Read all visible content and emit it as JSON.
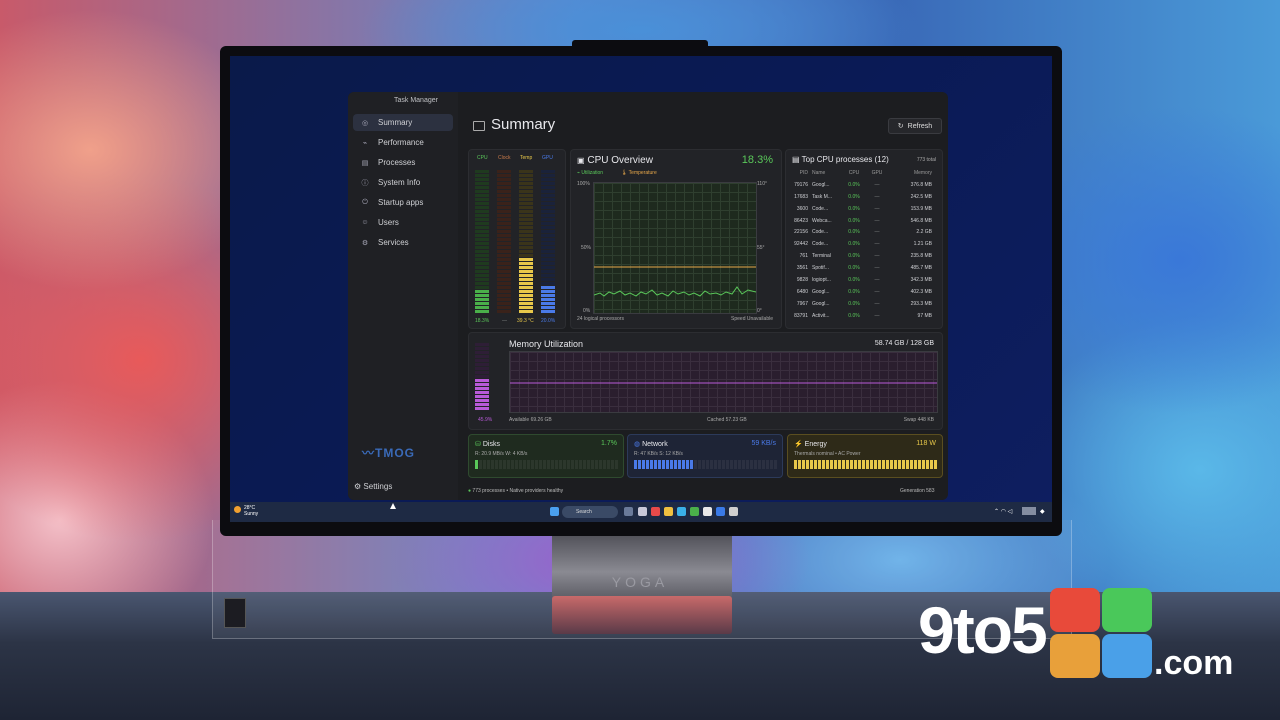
{
  "window": {
    "title": "Task Manager"
  },
  "sidebar": {
    "items": [
      {
        "label": "Summary",
        "icon": "gauge-icon"
      },
      {
        "label": "Performance",
        "icon": "pulse-icon"
      },
      {
        "label": "Processes",
        "icon": "list-icon"
      },
      {
        "label": "System Info",
        "icon": "info-icon"
      },
      {
        "label": "Startup apps",
        "icon": "power-icon"
      },
      {
        "label": "Users",
        "icon": "users-icon"
      },
      {
        "label": "Services",
        "icon": "gears-icon"
      }
    ],
    "logo_text": "TMOG",
    "settings_label": "Settings"
  },
  "header": {
    "title": "Summary",
    "refresh_label": "Refresh"
  },
  "gauges": {
    "headers": [
      "CPU",
      "Clock",
      "Temp",
      "GPU"
    ],
    "values": [
      "18.3%",
      "—",
      "39.3 °C",
      "20.0%"
    ],
    "levels": [
      0.18,
      0.0,
      0.39,
      0.2
    ],
    "colors": [
      "#4ab04a",
      "#c86a3a",
      "#e8c84a",
      "#4a7ae8"
    ]
  },
  "cpu": {
    "title": "CPU Overview",
    "percent": "18.3%",
    "legend_util": "Utilization",
    "legend_temp": "Temperature",
    "y_left_top": "100%",
    "y_left_mid": "50%",
    "y_left_bot": "0%",
    "y_right_top": "110°",
    "y_right_mid": "55°",
    "y_right_bot": "0°",
    "footer_left": "24 logical processors",
    "footer_right": "Speed Unavailable"
  },
  "top": {
    "title": "Top CPU processes (12)",
    "total": "773 total",
    "columns": [
      "PID",
      "Name",
      "CPU",
      "GPU",
      "Memory"
    ],
    "rows": [
      [
        "79176",
        "Googl...",
        "0.0%",
        "—",
        "376.8 MB"
      ],
      [
        "17683",
        "Task M...",
        "0.0%",
        "—",
        "242.5 MB"
      ],
      [
        "3600",
        "Code...",
        "0.0%",
        "—",
        "153.9 MB"
      ],
      [
        "86423",
        "Webca...",
        "0.0%",
        "—",
        "546.8 MB"
      ],
      [
        "22156",
        "Code...",
        "0.0%",
        "—",
        "2.2 GB"
      ],
      [
        "92442",
        "Code...",
        "0.0%",
        "—",
        "1.21 GB"
      ],
      [
        "761",
        "Terminal",
        "0.0%",
        "—",
        "235.8 MB"
      ],
      [
        "3561",
        "Spotif...",
        "0.0%",
        "—",
        "485.7 MB"
      ],
      [
        "9828",
        "logiopt...",
        "0.0%",
        "—",
        "342.3 MB"
      ],
      [
        "6480",
        "Googl...",
        "0.0%",
        "—",
        "402.3 MB"
      ],
      [
        "7967",
        "Googl...",
        "0.0%",
        "—",
        "293.3 MB"
      ],
      [
        "83791",
        "Activit...",
        "0.0%",
        "—",
        "97 MB"
      ]
    ]
  },
  "memory": {
    "title": "Memory Utilization",
    "used": "58.74 GB / 128 GB",
    "percent": "45.9%",
    "level": 0.459,
    "available": "Available 69.26 GB",
    "cached": "Cached 57.23 GB",
    "swap": "Swap 448 KB"
  },
  "disks": {
    "title": "Disks",
    "value": "1.7%",
    "detail": "R: 20.9 MB/s  W: 4 KB/s",
    "color": "#5ac85a"
  },
  "network": {
    "title": "Network",
    "value": "59 KB/s",
    "detail": "R: 47 KB/s  S: 12 KB/s",
    "color": "#4a7ae8"
  },
  "energy": {
    "title": "Energy",
    "value": "118 W",
    "detail": "Thermals nominal • AC Power",
    "color": "#e8c84a"
  },
  "status": {
    "left": "773 processes • Native providers healthy",
    "right": "Generation 583"
  },
  "taskbar": {
    "weather_temp": "28°C",
    "weather_desc": "Sunny",
    "search": "Search"
  },
  "monitor": {
    "brand": "YOGA"
  },
  "watermark": {
    "main": "9to5",
    "suffix": ".com"
  }
}
